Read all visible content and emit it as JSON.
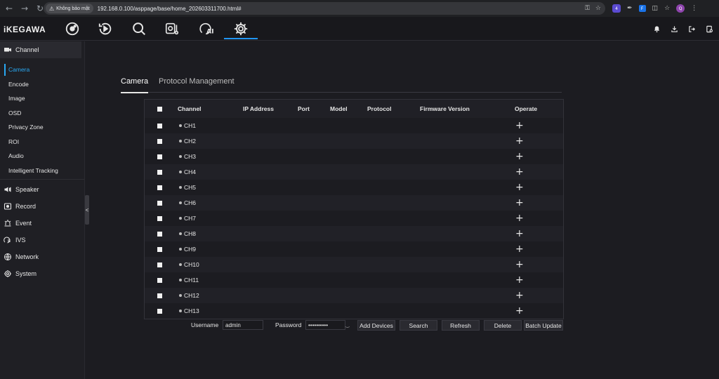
{
  "browser": {
    "security_label": "Không bảo mật",
    "url": "192.168.0.100/asppage/base/home_202603311700.html#",
    "avatar_letter": "Q",
    "ext_badge": "4",
    "ext_blue": "F"
  },
  "app": {
    "brand": "iKEGAWA",
    "top_icons": [
      "live-view-icon",
      "playback-icon",
      "search-icon",
      "smart-icon",
      "ai-icon",
      "settings-icon"
    ],
    "active_top": "settings-icon"
  },
  "sidebar": {
    "channel": "Channel",
    "items": [
      "Camera",
      "Encode",
      "Image",
      "OSD",
      "Privacy Zone",
      "ROI",
      "Audio",
      "Intelligent Tracking"
    ],
    "active_item": "Camera",
    "groups": [
      "Speaker",
      "Record",
      "Event",
      "IVS",
      "Network",
      "System"
    ],
    "collapse": "<"
  },
  "tabs": [
    "Camera",
    "Protocol Management"
  ],
  "table": {
    "headers": [
      "Channel",
      "IP Address",
      "Port",
      "Model",
      "Protocol",
      "Firmware Version",
      "Operate"
    ],
    "rows": [
      "CH1",
      "CH2",
      "CH3",
      "CH4",
      "CH5",
      "CH6",
      "CH7",
      "CH8",
      "CH9",
      "CH10",
      "CH11",
      "CH12",
      "CH13"
    ],
    "operate_symbol": "+"
  },
  "form": {
    "username_label": "Username",
    "username_value": "admin",
    "password_label": "Password",
    "password_value": "••••••••••",
    "buttons": [
      "Add Devices",
      "Search",
      "Refresh",
      "Delete",
      "Batch Update"
    ]
  },
  "colors": {
    "accent": "#29a8f2",
    "active_underline": "#2196f3"
  }
}
